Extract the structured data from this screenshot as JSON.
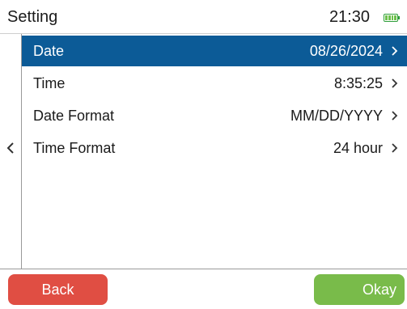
{
  "header": {
    "title": "Setting",
    "time": "21:30",
    "battery_icon": "battery-icon"
  },
  "sidebar": {
    "back_icon": "chevron-left-icon"
  },
  "settings": {
    "items": [
      {
        "label": "Date",
        "value": "08/26/2024",
        "selected": true
      },
      {
        "label": "Time",
        "value": "8:35:25",
        "selected": false
      },
      {
        "label": "Date Format",
        "value": "MM/DD/YYYY",
        "selected": false
      },
      {
        "label": "Time Format",
        "value": "24 hour",
        "selected": false
      }
    ]
  },
  "footer": {
    "back_label": "Back",
    "okay_label": "Okay"
  },
  "colors": {
    "selected_row": "#0c5b97",
    "back_button": "#e04e43",
    "okay_button": "#79bb4a",
    "battery": "#6cc04a"
  }
}
